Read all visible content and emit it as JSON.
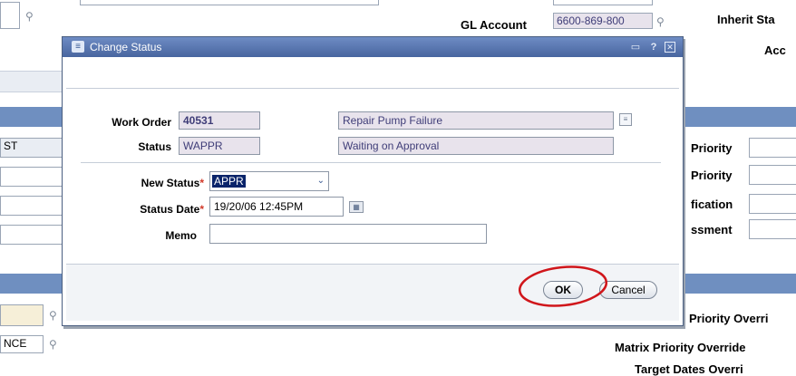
{
  "background": {
    "gl_account_label": "GL Account",
    "gl_account_value": "6600-869-800",
    "inherit_status_label": "Inherit Sta",
    "acc_label": "Acc",
    "priority_label": "Priority",
    "priority2_label": "Priority",
    "fication_label": "fication",
    "ssment_label": "ssment",
    "st_field": "ST",
    "nce_field": "NCE",
    "priority_override_label": "Priority Overri",
    "matrix_priority_override_label": "Matrix Priority Override",
    "target_dates_override_label": "Target Dates Overri"
  },
  "dialog": {
    "title": "Change Status",
    "work_order_label": "Work Order",
    "work_order_value": "40531",
    "work_order_description": "Repair Pump Failure",
    "status_label": "Status",
    "status_value": "WAPPR",
    "status_description": "Waiting on Approval",
    "new_status_label": "New Status",
    "new_status_value": "APPR",
    "status_date_label": "Status Date",
    "status_date_value": "19/20/06 12:45PM",
    "memo_label": "Memo",
    "memo_value": "",
    "required_mark": "*",
    "ok_label": "OK",
    "cancel_label": "Cancel"
  },
  "colors": {
    "titlebar": "#5a76b0",
    "highlight_circle": "#d0161b",
    "selection": "#0a246a"
  },
  "icons": [
    "dialog-icon",
    "maximize-icon",
    "help-icon",
    "close-icon",
    "long-description-icon",
    "calendar-icon",
    "search-icon",
    "dropdown-chevron-icon"
  ]
}
